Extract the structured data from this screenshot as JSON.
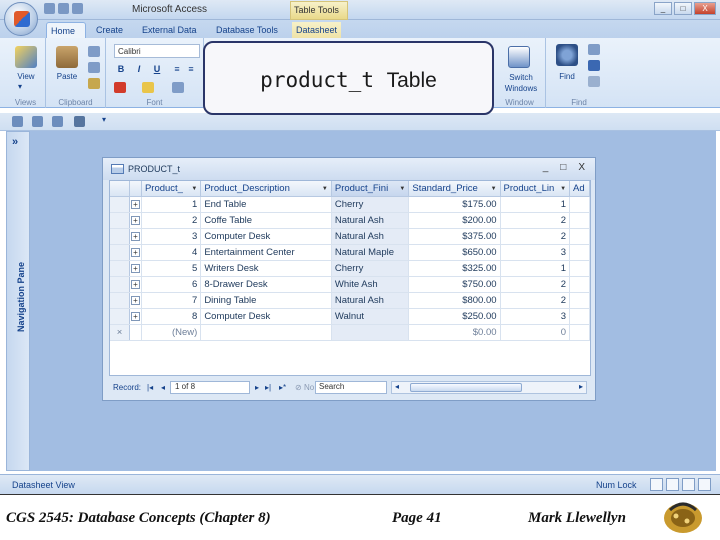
{
  "window": {
    "app_title": "Microsoft Access",
    "context_title": "Table Tools",
    "controls": [
      "_",
      "□",
      "X"
    ]
  },
  "tabs": [
    {
      "label": "Home",
      "active": true
    },
    {
      "label": "Create",
      "active": false
    },
    {
      "label": "External Data",
      "active": false
    },
    {
      "label": "Database Tools",
      "active": false
    },
    {
      "label": "Datasheet",
      "active": false,
      "contextual": true
    }
  ],
  "ribbon": {
    "views": {
      "view_label": "View",
      "group": "Views"
    },
    "clipboard": {
      "paste_label": "Paste",
      "group": "Clipboard"
    },
    "font": {
      "font_name": "Calibri",
      "bold": "B",
      "italic": "I",
      "underline": "U",
      "group": "Font"
    },
    "window": {
      "switch_label": "Switch Windows",
      "group": "Window"
    },
    "find": {
      "find_label": "Find",
      "group": "Find"
    }
  },
  "overlay": {
    "code": "product_t",
    "word": "Table"
  },
  "navigation_pane": {
    "label": "Navigation Pane",
    "chevron": "»"
  },
  "table_window": {
    "title": "PRODUCT_t",
    "controls": [
      "_",
      "□",
      "X"
    ],
    "columns": [
      "Product_",
      "Product_Description",
      "Product_Fini",
      "Standard_Price",
      "Product_Lin",
      "Ad"
    ],
    "rows": [
      {
        "id": "1",
        "description": "End Table",
        "finish": "Cherry",
        "price": "$175.00",
        "line": "1"
      },
      {
        "id": "2",
        "description": "Coffe Table",
        "finish": "Natural Ash",
        "price": "$200.00",
        "line": "2"
      },
      {
        "id": "3",
        "description": "Computer Desk",
        "finish": "Natural Ash",
        "price": "$375.00",
        "line": "2"
      },
      {
        "id": "4",
        "description": "Entertainment Center",
        "finish": "Natural Maple",
        "price": "$650.00",
        "line": "3"
      },
      {
        "id": "5",
        "description": "Writers Desk",
        "finish": "Cherry",
        "price": "$325.00",
        "line": "1"
      },
      {
        "id": "6",
        "description": "8-Drawer Desk",
        "finish": "White Ash",
        "price": "$750.00",
        "line": "2"
      },
      {
        "id": "7",
        "description": "Dining Table",
        "finish": "Natural Ash",
        "price": "$800.00",
        "line": "2"
      },
      {
        "id": "8",
        "description": "Computer Desk",
        "finish": "Walnut",
        "price": "$250.00",
        "line": "3"
      }
    ],
    "new_row": {
      "selector": "×",
      "label": "(New)",
      "price": "$0.00",
      "line": "0"
    },
    "record_nav": {
      "label": "Record:",
      "position": "1 of 8",
      "filter": "No Filter",
      "search": "Search"
    }
  },
  "status": {
    "left": "Datasheet View",
    "right": "Num Lock"
  },
  "footer": {
    "course": "CGS 2545: Database Concepts  (Chapter 8)",
    "page": "Page 41",
    "author": "Mark Llewellyn"
  }
}
